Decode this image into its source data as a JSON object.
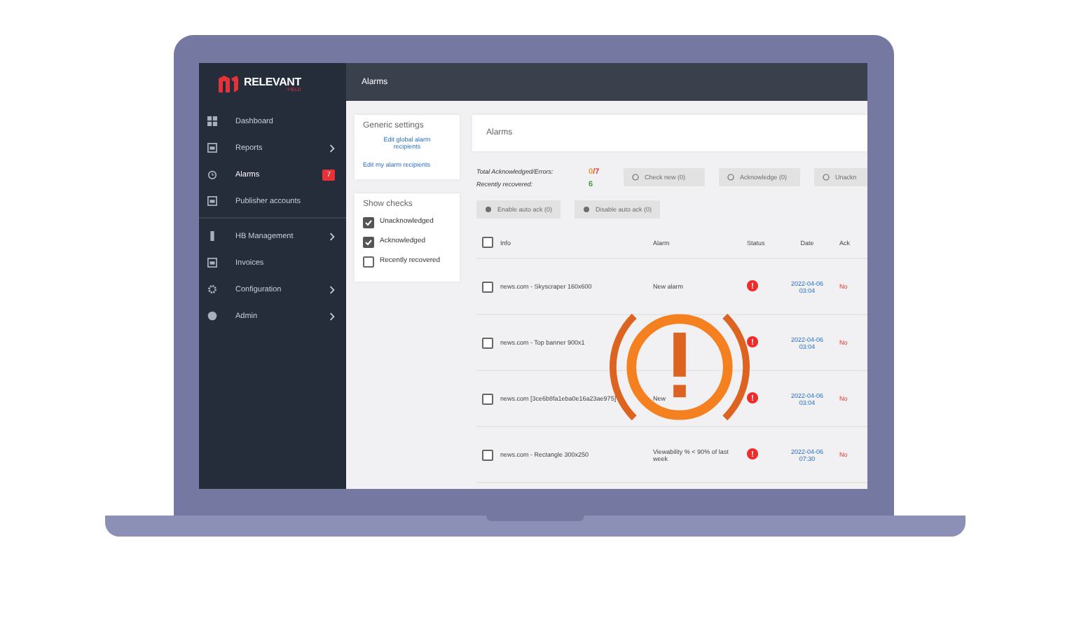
{
  "header": {
    "title": "Alarms"
  },
  "sidebar": {
    "logo": "RELEVANT",
    "logo_sub": "YIELD",
    "groups": [
      [
        {
          "label": "Dashboard",
          "submenu": false,
          "selected": false
        },
        {
          "label": "Reports",
          "submenu": true,
          "selected": false
        },
        {
          "label": "Alarms",
          "submenu": false,
          "selected": true,
          "badge": "7"
        },
        {
          "label": "Publisher accounts",
          "submenu": false,
          "selected": false
        }
      ],
      [
        {
          "label": "HB Management",
          "submenu": true,
          "selected": false
        },
        {
          "label": "Invoices",
          "submenu": false,
          "selected": false
        },
        {
          "label": "Configuration",
          "submenu": true,
          "selected": false
        },
        {
          "label": "Admin",
          "submenu": true,
          "selected": false
        }
      ]
    ]
  },
  "settings": {
    "title": "Generic settings",
    "links": [
      "Edit global alarm recipients",
      "Edit my alarm recipients"
    ]
  },
  "show_checks": {
    "title": "Show checks",
    "items": [
      {
        "label": "Unacknowledged",
        "checked": true
      },
      {
        "label": "Acknowledged",
        "checked": true
      },
      {
        "label": "Recently recovered",
        "checked": false
      }
    ]
  },
  "alarms": {
    "title": "Alarms",
    "stats": [
      {
        "label": "Total Acknowledged/Errors:",
        "values": [
          {
            "text": "0",
            "color": "#f39a2b"
          },
          {
            "text": "/7",
            "color": "#e53935"
          }
        ]
      },
      {
        "label": "Recently recovered:",
        "values": [
          {
            "text": "6",
            "color": "#43a047"
          }
        ]
      }
    ],
    "button_rows": [
      [
        {
          "label": "Check new (0)",
          "disabled": true
        },
        {
          "label": "Acknowledge (0)",
          "disabled": true
        },
        {
          "label": "Unackn",
          "disabled": true
        }
      ],
      [
        {
          "label": "Enable auto ack (0)",
          "disabled": true
        },
        {
          "label": "Disable auto ack (0)",
          "disabled": true
        }
      ]
    ],
    "select_all": {
      "checked": false
    },
    "columns": [
      "Info",
      "Alarm",
      "Status",
      "Date",
      "Ack"
    ],
    "rows": [
      {
        "checked": false,
        "info": "news.com - Skyscraper 160x600",
        "alarm": "New alarm",
        "date": "2022-04-06 03:04",
        "ack": "No"
      },
      {
        "checked": false,
        "info": "news.com - Top banner 900x1",
        "date": "2022-04-06 03:04",
        "ack": "No"
      },
      {
        "checked": false,
        "info": "news.com [3ce6b8fa1eba0e16a23ae975]",
        "alarm": "New",
        "date": "2022-04-06 03:04",
        "ack": "No"
      },
      {
        "checked": false,
        "info": "news.com - Rectangle 300x250",
        "alarm": "Viewability % < 90% of last week",
        "date": "2022-04-06 07:30",
        "ack": "No"
      }
    ]
  }
}
